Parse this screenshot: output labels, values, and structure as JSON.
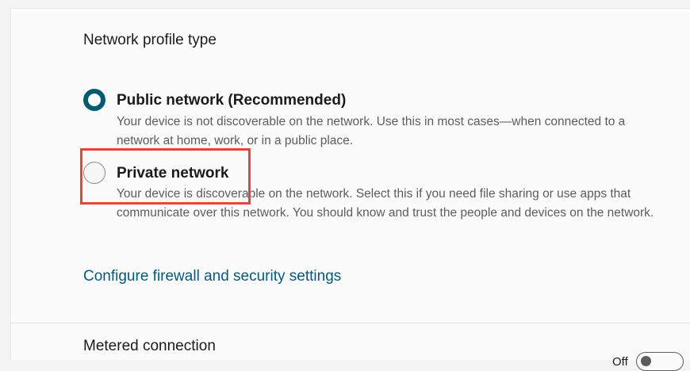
{
  "network_profile": {
    "title": "Network profile type",
    "options": [
      {
        "label": "Public network (Recommended)",
        "description": "Your device is not discoverable on the network. Use this in most cases—when connected to a network at home, work, or in a public place.",
        "selected": true
      },
      {
        "label": "Private network",
        "description": "Your device is discoverable on the network. Select this if you need file sharing or use apps that communicate over this network. You should know and trust the people and devices on the network.",
        "selected": false
      }
    ],
    "firewall_link": "Configure firewall and security settings"
  },
  "metered": {
    "title": "Metered connection",
    "toggle_state_label": "Off"
  },
  "colors": {
    "accent": "#005a70",
    "link": "#005a80",
    "highlight": "#e8443c"
  }
}
